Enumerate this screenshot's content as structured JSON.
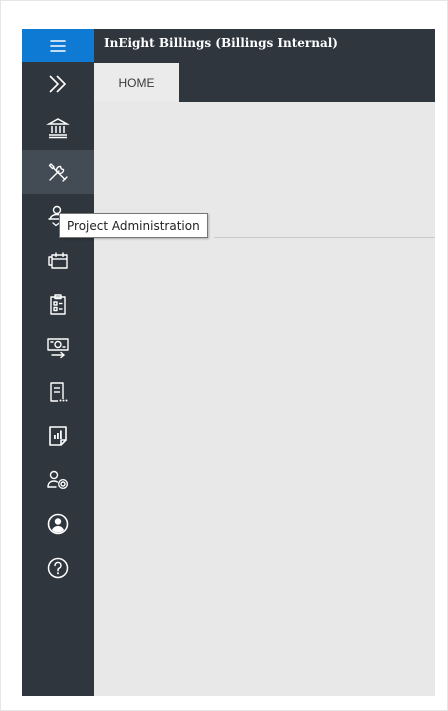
{
  "app": {
    "title": "InEight Billings  (Billings Internal)"
  },
  "tabs": [
    {
      "label": "HOME",
      "active": true
    }
  ],
  "tooltip": {
    "text": "Project Administration"
  },
  "sidebar": {
    "items": [
      {
        "icon": "hamburger-menu-icon"
      },
      {
        "icon": "double-chevron-right-icon"
      },
      {
        "icon": "bank-icon"
      },
      {
        "icon": "tools-icon",
        "hovered": true
      },
      {
        "icon": "user-approve-icon"
      },
      {
        "icon": "calendar-folder-icon"
      },
      {
        "icon": "clipboard-checklist-icon"
      },
      {
        "icon": "money-transfer-icon"
      },
      {
        "icon": "document-ellipsis-icon"
      },
      {
        "icon": "report-chart-icon"
      },
      {
        "icon": "user-settings-icon"
      },
      {
        "icon": "user-profile-icon"
      },
      {
        "icon": "help-icon"
      }
    ]
  },
  "colors": {
    "sidebar": "#2f363d",
    "menu_button": "#0f7ad4",
    "hover_item": "#434b54",
    "content_bg": "#e8e8e8"
  }
}
